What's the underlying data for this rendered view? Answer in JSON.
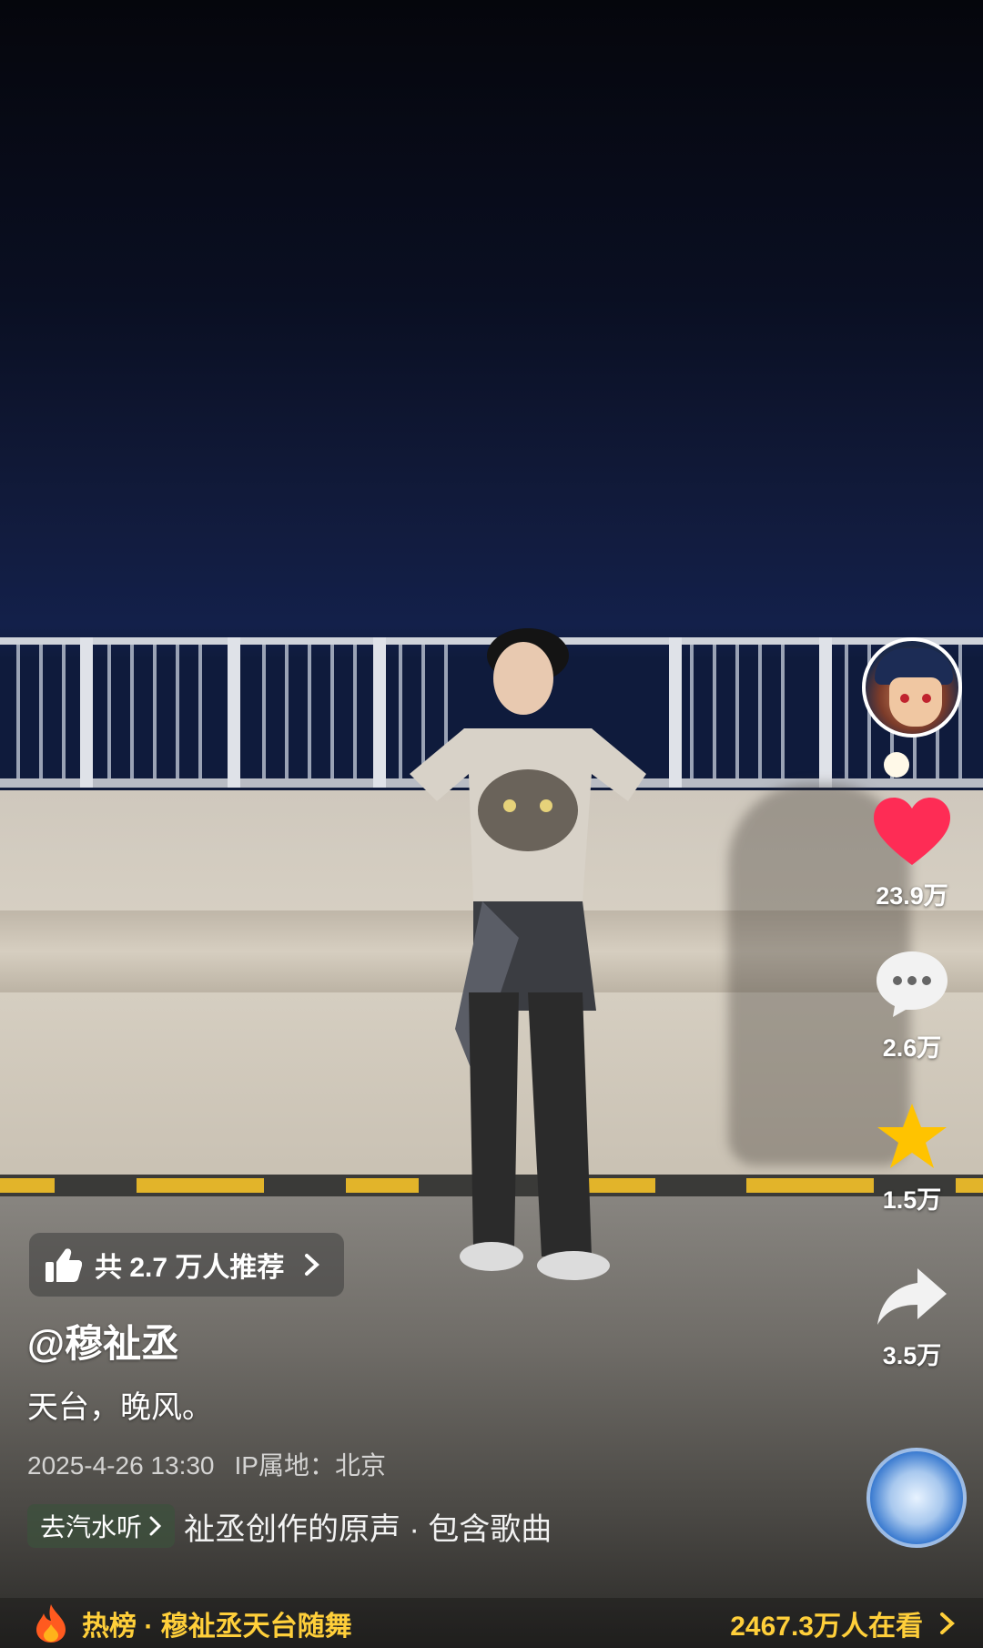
{
  "stats": {
    "likes": "23.9万",
    "comments": "2.6万",
    "favorites": "1.5万",
    "shares": "3.5万"
  },
  "recommend": {
    "text": "共 2.7 万人推荐"
  },
  "post": {
    "author": "@穆祉丞",
    "caption": "天台，晚风。",
    "datetime": "2025-4-26 13:30",
    "location": "IP属地：北京"
  },
  "music": {
    "button_label": "去汽水听",
    "track_text": "祉丞创作的原声 · 包含歌曲"
  },
  "hot": {
    "left_text": "热榜 · 穆祉丞天台随舞",
    "right_text": "2467.3万人在看"
  },
  "colors": {
    "like": "#fe2c55",
    "favorite": "#ffc300",
    "hot_text": "#ffcf3a"
  }
}
